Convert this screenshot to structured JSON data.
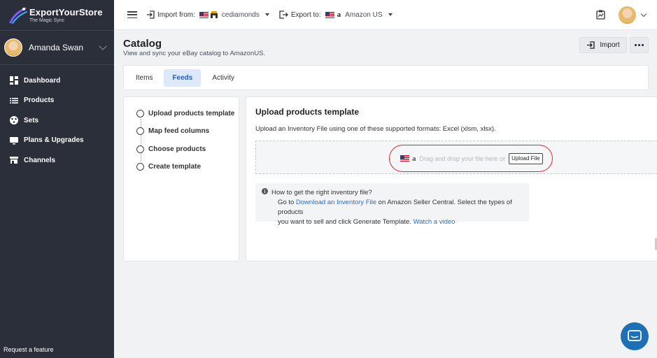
{
  "app": {
    "logo_title": "ExportYourStore",
    "logo_subtitle": "The Magic Sync"
  },
  "sidebar": {
    "user_name": "Amanda Swan",
    "items": [
      {
        "label": "Dashboard",
        "icon": "dashboard-icon"
      },
      {
        "label": "Products",
        "icon": "list-icon"
      },
      {
        "label": "Sets",
        "icon": "sets-icon"
      },
      {
        "label": "Plans & Upgrades",
        "icon": "monitor-icon"
      },
      {
        "label": "Channels",
        "icon": "store-icon"
      }
    ],
    "request_feature": "Request a feature"
  },
  "topbar": {
    "import_label": "Import from:",
    "import_store": "cediamonds",
    "export_label": "Export to:",
    "export_store": "Amazon US"
  },
  "page": {
    "title": "Catalog",
    "subtitle": "View and sync your eBay catalog to AmazonUS.",
    "import_button": "Import"
  },
  "tabs": [
    {
      "label": "Items",
      "active": false
    },
    {
      "label": "Feeds",
      "active": true
    },
    {
      "label": "Activity",
      "active": false
    }
  ],
  "steps": [
    "Upload products template",
    "Map feed columns",
    "Choose products",
    "Create template"
  ],
  "upload": {
    "title": "Upload products template",
    "description": "Upload an Inventory File using one of these supported formats: Excel (xlsm, xlsx).",
    "drop_text": "Drag and drop your file here or",
    "upload_button": "Upload File",
    "info_title": "How to get the right inventory file?",
    "info_go_to": "Go to",
    "info_link": "Download an Inventory File",
    "info_rest_1": "on Amazon Seller Central. Select the types of products",
    "info_rest_2": "you want to sell and click Generate Template.",
    "info_video_link": "Watch a video"
  },
  "colors": {
    "sidebar_bg": "#2b2f3a",
    "accent": "#1f6fd9",
    "active_tab_bg": "#dde9fb",
    "highlight_ring": "#e0262e",
    "chat_bubble": "#1f6fb5"
  }
}
